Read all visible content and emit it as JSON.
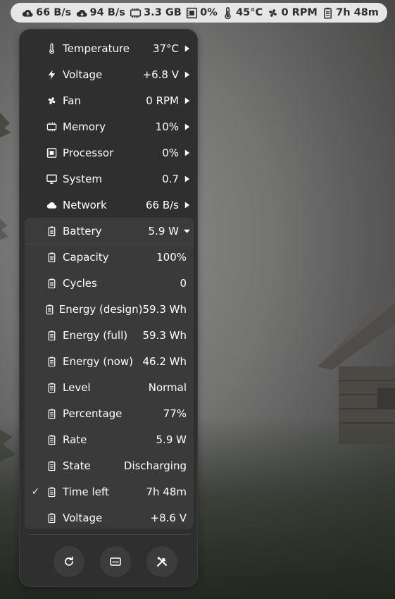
{
  "panel": {
    "items": [
      {
        "icon": "cloud-upload-icon",
        "value": "66 B/s"
      },
      {
        "icon": "cloud-download-icon",
        "value": "94 B/s"
      },
      {
        "icon": "memory-icon",
        "value": "3.3 GB"
      },
      {
        "icon": "processor-icon",
        "value": "0%"
      },
      {
        "icon": "thermometer-icon",
        "value": "45°C"
      },
      {
        "icon": "fan-icon",
        "value": "0 RPM"
      },
      {
        "icon": "battery-icon",
        "value": "7h 48m"
      }
    ]
  },
  "menu": {
    "items": [
      {
        "label": "Temperature",
        "value": "37°C",
        "icon": "thermometer-icon"
      },
      {
        "label": "Voltage",
        "value": "+6.8 V",
        "icon": "bolt-icon"
      },
      {
        "label": "Fan",
        "value": "0 RPM",
        "icon": "fan-icon"
      },
      {
        "label": "Memory",
        "value": "10%",
        "icon": "memory-icon"
      },
      {
        "label": "Processor",
        "value": "0%",
        "icon": "processor-icon"
      },
      {
        "label": "System",
        "value": "0.7",
        "icon": "monitor-icon"
      },
      {
        "label": "Network",
        "value": "66 B/s",
        "icon": "cloud-icon"
      },
      {
        "label": "Battery",
        "value": "5.9 W",
        "icon": "battery-icon",
        "expanded": true
      }
    ],
    "battery_details": [
      {
        "label": "Capacity",
        "value": "100%"
      },
      {
        "label": "Cycles",
        "value": "0"
      },
      {
        "label": "Energy (design)",
        "value": "59.3 Wh"
      },
      {
        "label": "Energy (full)",
        "value": "59.3 Wh"
      },
      {
        "label": "Energy (now)",
        "value": "46.2 Wh"
      },
      {
        "label": "Level",
        "value": "Normal"
      },
      {
        "label": "Percentage",
        "value": "77%"
      },
      {
        "label": "Rate",
        "value": "5.9 W"
      },
      {
        "label": "State",
        "value": "Discharging"
      },
      {
        "label": "Time left",
        "value": "7h 48m",
        "checked": true,
        "check": "✓"
      },
      {
        "label": "Voltage",
        "value": "+8.6 V"
      }
    ],
    "buttons": [
      {
        "name": "refresh",
        "icon": "refresh-icon"
      },
      {
        "name": "system-monitor",
        "icon": "monitor-app-icon"
      },
      {
        "name": "preferences",
        "icon": "tools-icon"
      }
    ]
  },
  "colors": {
    "panel_bg": "#e6e6e6",
    "menu_bg": "#2f2f2f",
    "submenu_bg": "#3a3a3a",
    "text": "#ffffff"
  }
}
